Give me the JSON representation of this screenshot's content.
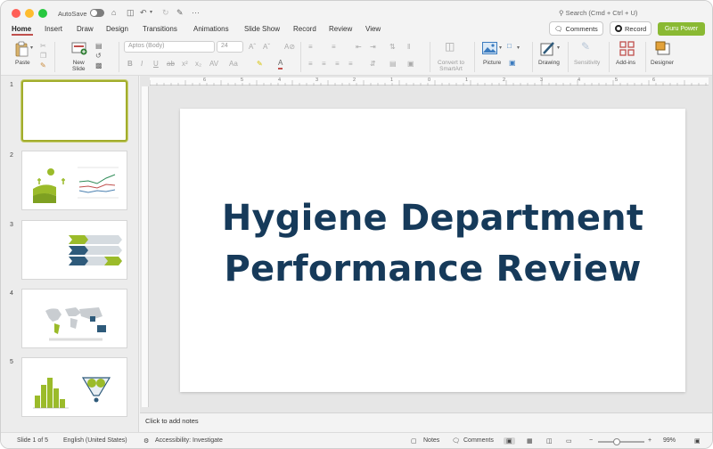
{
  "titlebar": {
    "autosave_label": "AutoSave",
    "search_placeholder": "Search (Cmd + Ctrl + U)",
    "more_glyph": "···"
  },
  "tabs": [
    "Home",
    "Insert",
    "Draw",
    "Design",
    "Transitions",
    "Animations",
    "Slide Show",
    "Record",
    "Review",
    "View"
  ],
  "active_tab": "Home",
  "ribbon_right": {
    "comments_label": "Comments",
    "record_label": "Record",
    "guru_label": "Guru Power"
  },
  "ribbon": {
    "paste_label": "Paste",
    "new_slide_label_1": "New",
    "new_slide_label_2": "Slide",
    "font_name": "Aptos (Body)",
    "font_size": "24",
    "convert_label_1": "Convert to",
    "convert_label_2": "SmartArt",
    "picture_label": "Picture",
    "drawing_label": "Drawing",
    "sensitivity_label": "Sensitivity",
    "addins_label": "Add-ins",
    "designer_label": "Designer"
  },
  "ruler_numbers": [
    "6",
    "5",
    "4",
    "3",
    "2",
    "1",
    "0",
    "1",
    "2",
    "3",
    "4",
    "5",
    "6"
  ],
  "thumbnails": [
    {
      "number": "1",
      "selected": true
    },
    {
      "number": "2",
      "selected": false
    },
    {
      "number": "3",
      "selected": false
    },
    {
      "number": "4",
      "selected": false
    },
    {
      "number": "5",
      "selected": false
    }
  ],
  "slide": {
    "title_line_1": "Hygiene Department",
    "title_line_2": "Performance Review"
  },
  "notes": {
    "placeholder": "Click to add notes"
  },
  "status": {
    "slide_counter": "Slide 1 of 5",
    "language": "English (United States)",
    "accessibility": "Accessibility: Investigate",
    "notes_label": "Notes",
    "comments_label": "Comments",
    "zoom": "99%"
  },
  "colors": {
    "accent_red": "#c0504d",
    "guru_green": "#8ab933",
    "title_navy": "#163a5a",
    "thumb_green": "#9bbb2a",
    "thumb_navy": "#2e5a7a",
    "selected_border": "#a2ad2c"
  }
}
